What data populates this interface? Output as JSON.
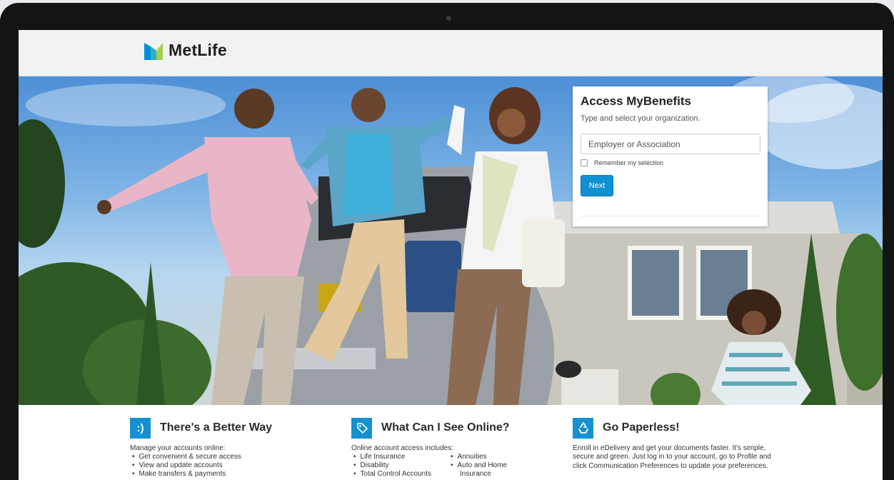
{
  "brand": {
    "name": "MetLife"
  },
  "login_panel": {
    "title": "Access MyBenefits",
    "subtitle": "Type and select your organization.",
    "organization_placeholder": "Employer or Association",
    "remember_label": "Remember my selection",
    "next_label": "Next"
  },
  "features": [
    {
      "icon": ":)",
      "icon_name": "smiley-icon",
      "title": "There's a Better Way",
      "lead": "Manage your accounts online:",
      "items": [
        "Get convenient & secure access",
        "View and update accounts",
        "Make transfers & payments"
      ]
    },
    {
      "icon_name": "tag-icon",
      "title": "What Can I See Online?",
      "lead": "Online account access includes:",
      "items": [
        "Life Insurance",
        "Annuities",
        "Disability",
        "Auto and Home",
        "Total Control Accounts",
        "Insurance"
      ]
    },
    {
      "icon_name": "recycle-icon",
      "title": "Go Paperless!",
      "text": "Enroll in eDelivery and get your documents faster. It's simple, secure and green. Just log in to your account, go to Profile and click Communication Preferences to update your preferences."
    }
  ],
  "colors": {
    "accent": "#1591D1",
    "button": "#0F90D1",
    "logo_blue": "#0090DA",
    "logo_green": "#A4CE4E"
  }
}
